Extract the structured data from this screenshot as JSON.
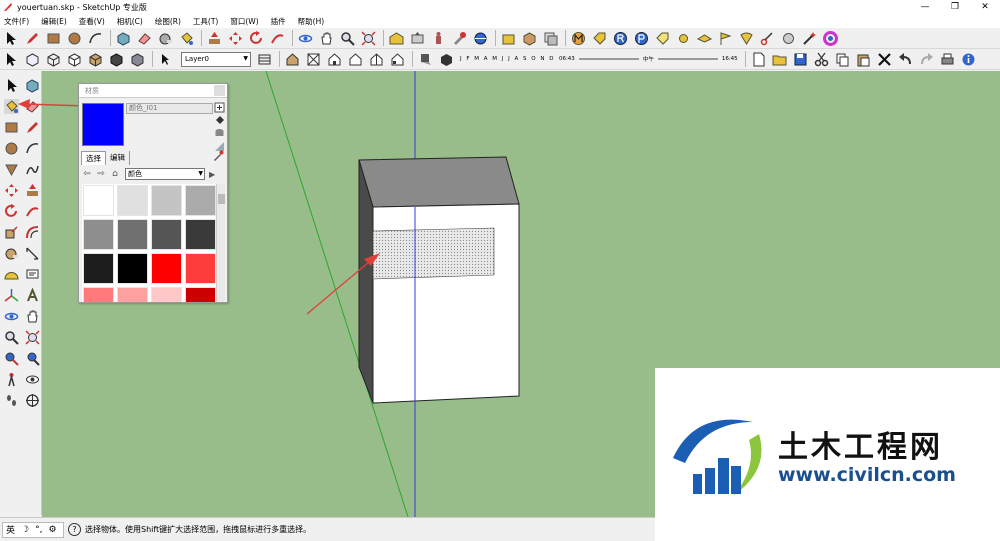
{
  "window": {
    "title": "youertuan.skp - SketchUp 专业版",
    "controls": [
      "—",
      "❐",
      "✕"
    ]
  },
  "menu": [
    "文件(F)",
    "编辑(E)",
    "查看(V)",
    "相机(C)",
    "绘图(R)",
    "工具(T)",
    "窗口(W)",
    "插件",
    "帮助(H)"
  ],
  "toolbar": {
    "layer_value": "Layer0",
    "shadow_months": "J F M A M J J A S O N D",
    "time_start": "06:43",
    "time_mid": "中午",
    "time_end": "16:45"
  },
  "materials_panel": {
    "title": "材质",
    "material_name": "颜色_I01",
    "current_color": "#0000ff",
    "tabs": [
      "选择",
      "编辑"
    ],
    "category": "颜色",
    "swatches": [
      "#ffffff",
      "#e0e0e0",
      "#c4c4c4",
      "#ababab",
      "#8e8e8e",
      "#707070",
      "#555555",
      "#3a3a3a",
      "#1d1d1d",
      "#000000",
      "#ff0000",
      "#ff3c3c",
      "#ff7a7a",
      "#ffa0a0",
      "#ffc8c8",
      "#cc0000"
    ]
  },
  "status": {
    "ime_lang": "英",
    "message": "选择物体。使用Shift键扩大选择范围，拖拽鼠标进行多重选择。"
  },
  "watermark": {
    "brand_cn": "土木工程网",
    "url": "www.civilcn.com"
  },
  "colors": {
    "viewport_bg": "#98bd8b",
    "arrow": "#e0403a"
  }
}
